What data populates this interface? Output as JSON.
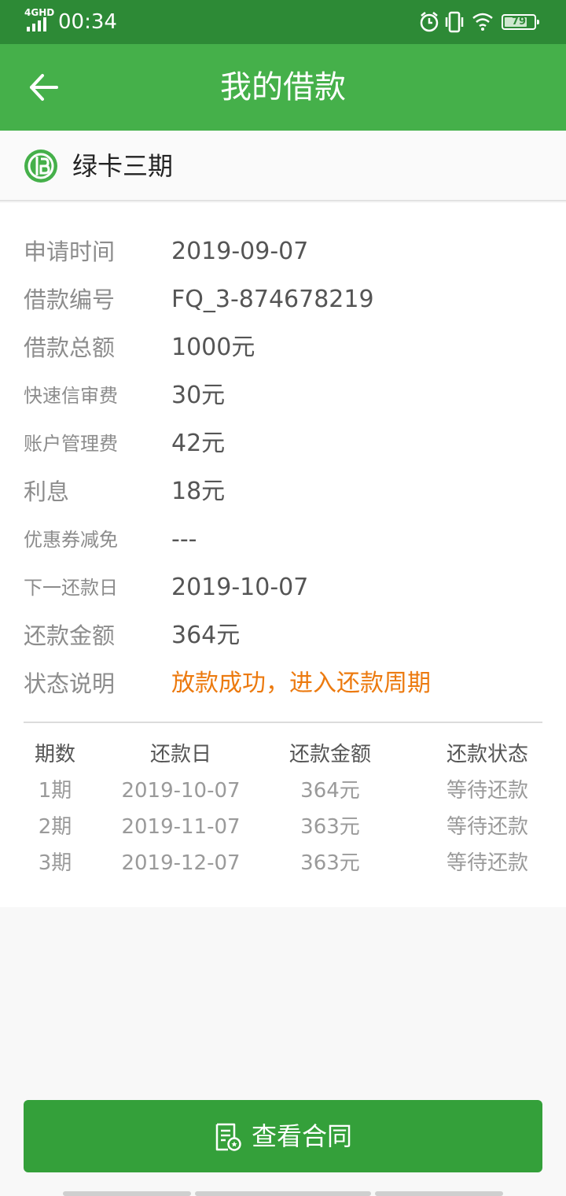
{
  "status_bar": {
    "network": "4GHD",
    "time": "00:34",
    "battery": "79",
    "battery_level": 0.79,
    "icons": [
      "signal-icon",
      "alarm-icon",
      "vibrate-icon",
      "wifi-icon",
      "battery-icon"
    ]
  },
  "header": {
    "title": "我的借款",
    "back_icon": "back-arrow-icon"
  },
  "card": {
    "name": "绿卡三期",
    "logo": "greencard-logo-icon"
  },
  "details": [
    {
      "label": "申请时间",
      "value": "2019-09-07"
    },
    {
      "label": "借款编号",
      "value": "FQ_3-874678219"
    },
    {
      "label": "借款总额",
      "value": "1000元"
    },
    {
      "label": "快速信审费",
      "value": "30元"
    },
    {
      "label": "账户管理费",
      "value": "42元"
    },
    {
      "label": "利息",
      "value": "18元"
    },
    {
      "label": "优惠券减免",
      "value": "---"
    },
    {
      "label": "下一还款日",
      "value": "2019-10-07"
    },
    {
      "label": "还款金额",
      "value": "364元"
    },
    {
      "label": "状态说明",
      "value": "放款成功，进入还款周期"
    }
  ],
  "schedule": {
    "headers": [
      "期数",
      "还款日",
      "还款金额",
      "还款状态"
    ],
    "rows": [
      [
        "1期",
        "2019-10-07",
        "364元",
        "等待还款"
      ],
      [
        "2期",
        "2019-11-07",
        "363元",
        "等待还款"
      ],
      [
        "3期",
        "2019-12-07",
        "363元",
        "等待还款"
      ]
    ]
  },
  "footer": {
    "button_label": "查看合同",
    "button_icon": "contract-document-icon"
  },
  "colors": {
    "status_bar": "#2d8a36",
    "header": "#45b04a",
    "button": "#34a03a",
    "highlight": "#ec7a0f"
  }
}
